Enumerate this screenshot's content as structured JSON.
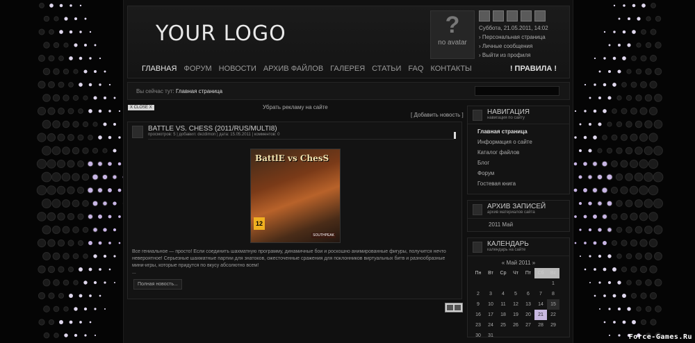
{
  "logo": "YOUR LOGO",
  "avatar": {
    "icon": "question-mark",
    "label": "no avatar"
  },
  "user_panel": {
    "date": "Суббота, 21.05.2011, 14:02",
    "links": [
      "Персональная страница",
      "Личные сообщения",
      "Выйти из профиля"
    ]
  },
  "nav": {
    "items": [
      "ГЛАВНАЯ",
      "ФОРУМ",
      "НОВОСТИ",
      "АРХИВ ФАЙЛОВ",
      "ГАЛЕРЕЯ",
      "СТАТЬИ",
      "FAQ",
      "КОНТАКТЫ"
    ],
    "rules": "! ПРАВИЛА !"
  },
  "breadcrumb": {
    "prefix": "Вы сейчас тут:",
    "current": "Главная страница"
  },
  "ad": {
    "close": "X CLOSE X",
    "remove": "Убрать рекламу на сайте"
  },
  "add_news": "[ Добавить новость ]",
  "post": {
    "title": "BATTLE VS. CHESS (2011/RUS/MULTI8)",
    "meta": "просмотров: 5 | добавил: dezdimon | дата: 15.05.2011 | комментов: 0",
    "cover_title": "BattlE vs ChesS",
    "cover_age": "12",
    "cover_publisher": "SOUTHPEAK",
    "body": "Все гениальное — просто! Если соединить шахматную программу, динамичные бои и роскошно анимированные фигуры, получится нечто невероятное! Серьезные шахматные партии для знатоков, ожесточенные сражения для поклонников виртуальных битв и разнообразные мини-игры, которые придутся по вкусу абсолютно всем!",
    "ellipsis": "...",
    "more": "Полная новость..."
  },
  "sidebar": {
    "navigation": {
      "title": "НАВИГАЦИЯ",
      "subtitle": "навигация по сайту",
      "items": [
        "Главная страница",
        "Информация о сайте",
        "Каталог файлов",
        "Блог",
        "Форум",
        "Гостевая книга"
      ]
    },
    "archive": {
      "title": "АРХИВ ЗАПИСЕЙ",
      "subtitle": "архив материалов сайта",
      "items": [
        "2011 Май"
      ]
    },
    "calendar": {
      "title": "КАЛЕНДАРЬ",
      "subtitle": "календарь на сайте",
      "prev": "«",
      "month": "Май 2011",
      "next": "»",
      "days": [
        "Пн",
        "Вт",
        "Ср",
        "Чт",
        "Пт",
        "Сб",
        "Вс"
      ],
      "weeks": [
        [
          "",
          "",
          "",
          "",
          "",
          "",
          "1"
        ],
        [
          "2",
          "3",
          "4",
          "5",
          "6",
          "7",
          "8"
        ],
        [
          "9",
          "10",
          "11",
          "12",
          "13",
          "14",
          "15"
        ],
        [
          "16",
          "17",
          "18",
          "19",
          "20",
          "21",
          "22"
        ],
        [
          "23",
          "24",
          "25",
          "26",
          "27",
          "28",
          "29"
        ],
        [
          "30",
          "31",
          "",
          "",
          "",
          "",
          ""
        ]
      ],
      "today": "21"
    }
  },
  "watermark": "Force-Games.Ru"
}
